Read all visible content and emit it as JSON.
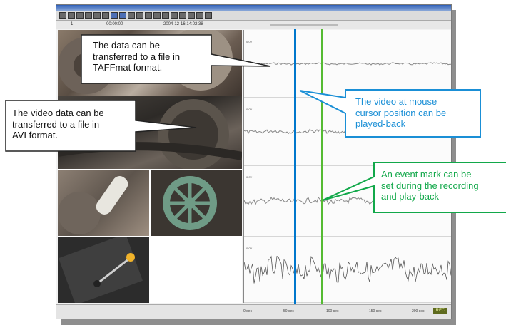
{
  "toolbar": {
    "left_value": "1",
    "time_display": "00:00:00",
    "date_display": "2004-12-16 14:02:38"
  },
  "plot": {
    "axis_label": "0.0V"
  },
  "statusbar": {
    "x_ticks": [
      "0 sec",
      "50 sec",
      "100 sec",
      "150 sec",
      "200 sec"
    ],
    "indicator": "REC"
  },
  "callouts": {
    "taffmat": "The data can be\ntransferred to a file in\nTAFFmat format.",
    "avi": "The video data can be\ntransferred to a file in\nAVI format.",
    "cursor": "The video at mouse\ncursor position can be\nplayed-back",
    "event": "An event mark can be\nset during the recording\nand play-back"
  },
  "colors": {
    "cursor_line": "#0077cc",
    "event_line": "#55bb33",
    "callout_cursor": "#1a8fd6",
    "callout_event": "#12a84a"
  }
}
